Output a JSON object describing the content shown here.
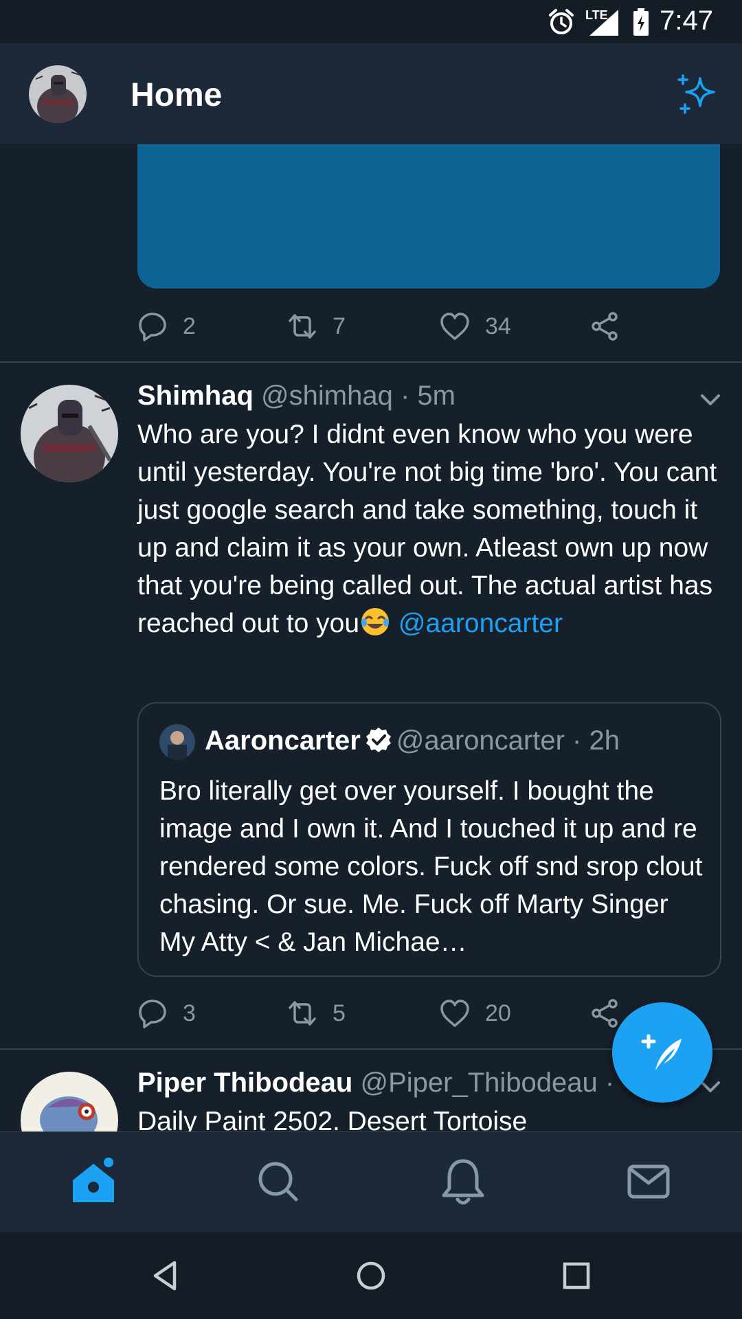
{
  "status_bar": {
    "time": "7:47",
    "network": "LTE"
  },
  "header": {
    "title": "Home"
  },
  "prev_tweet": {
    "stats": {
      "replies": "2",
      "retweets": "7",
      "likes": "34"
    }
  },
  "tweet": {
    "name": "Shimhaq",
    "handle": "@shimhaq",
    "separator": "·",
    "time": "5m",
    "text": "Who are you? I didnt even know who you were until yesterday. You're not big time 'bro'. You cant just google search and take something, touch it up and claim it as your own. Atleast own up now that you're being called out. The actual artist has reached out to you",
    "mention": "@aaroncarter",
    "quote": {
      "name": "Aaroncarter",
      "handle": "@aaroncarter",
      "separator": "·",
      "time": "2h",
      "text": "Bro literally get over yourself. I bought the image and I own it. And I touched it up and re rendered some colors. Fuck off snd srop clout chasing. Or sue. Me. Fuck off Marty Singer My Atty < & Jan Michae…"
    },
    "stats": {
      "replies": "3",
      "retweets": "5",
      "likes": "20"
    }
  },
  "next_tweet": {
    "name": "Piper Thibodeau",
    "handle": "@Piper_Thibodeau",
    "separator": "·",
    "text": "Daily Paint 2502. Desert Tortoise"
  },
  "bottom_nav": {
    "items": [
      "home-icon",
      "search-icon",
      "bell-icon",
      "mail-icon"
    ],
    "active_color": "#1da1f2",
    "inactive_color": "#8899a6"
  },
  "colors": {
    "background": "#15202b",
    "header": "#1c2938",
    "accent": "#1da1f2",
    "secondary_text": "#8899a6",
    "divider": "#38444d"
  }
}
